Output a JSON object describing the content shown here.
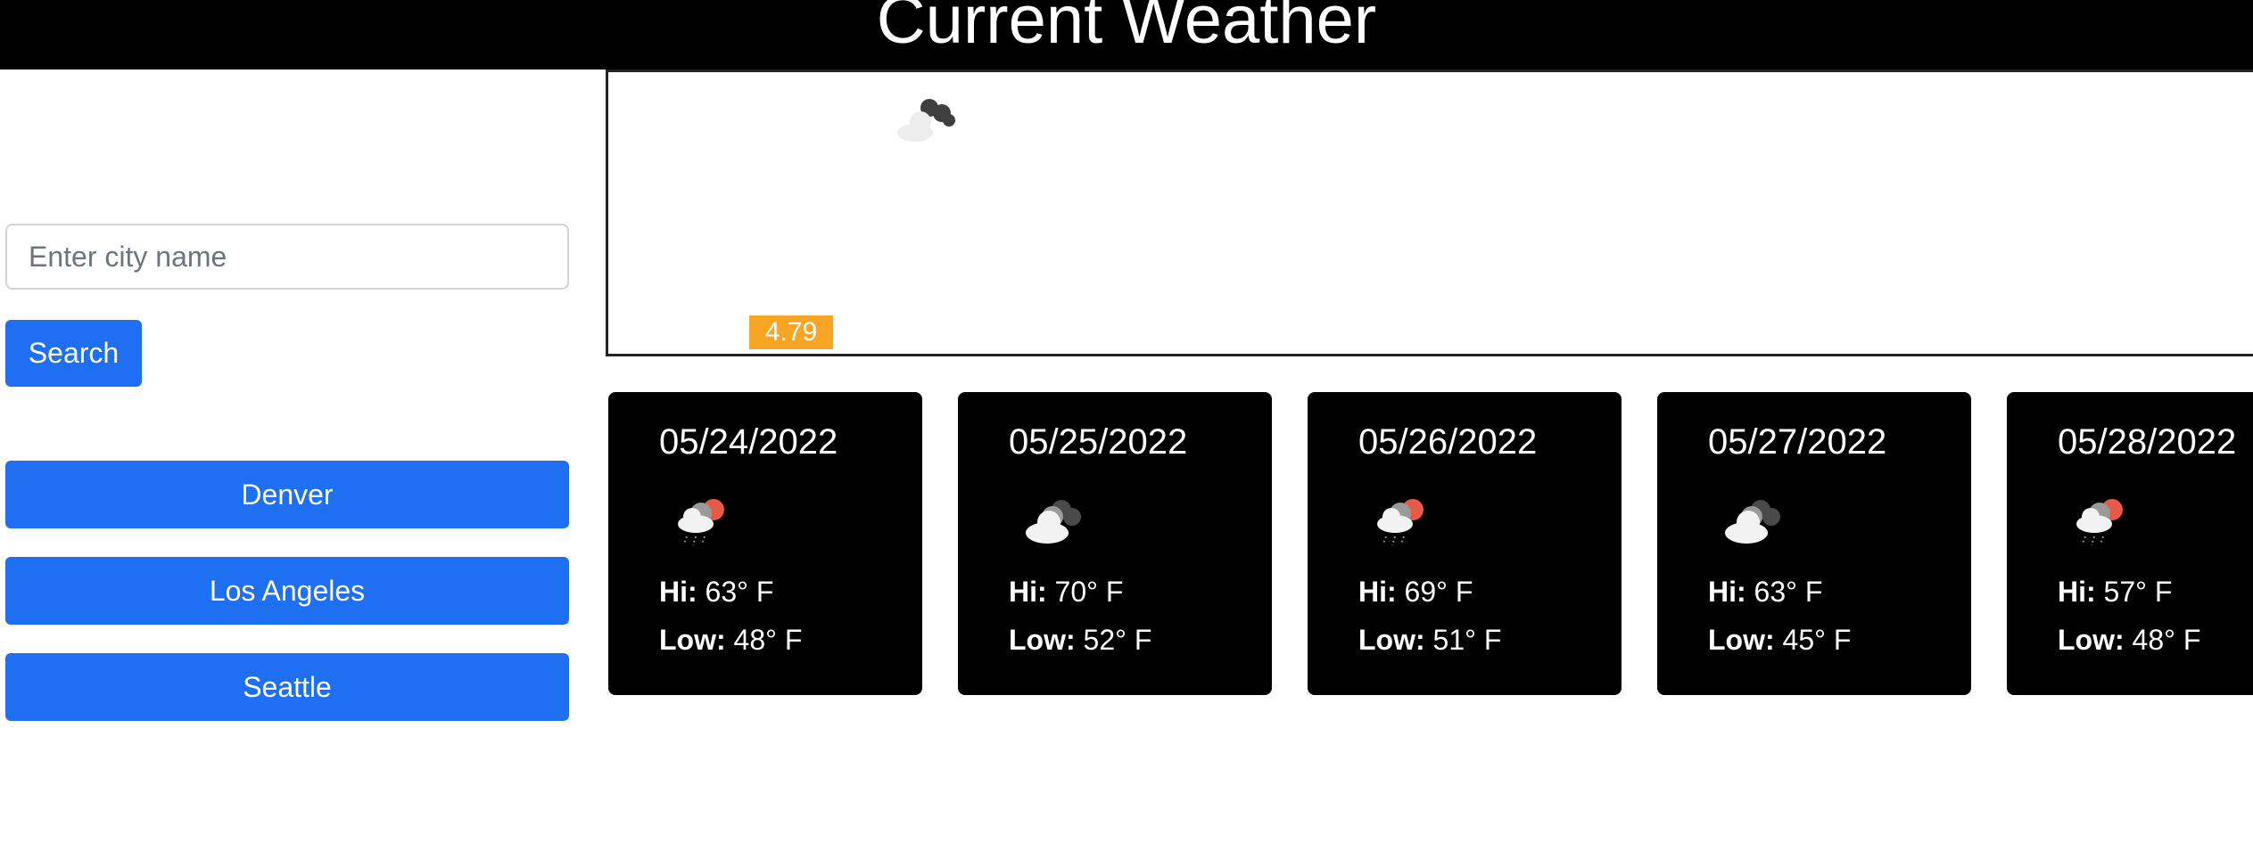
{
  "header": {
    "title": "Current Weather"
  },
  "sidebar": {
    "search_placeholder": "Enter city name",
    "search_button": "Search",
    "history": [
      "Denver",
      "Los Angeles",
      "Seattle"
    ]
  },
  "current": {
    "icon": "cloudy-night-icon",
    "wind_value": "4.79"
  },
  "forecast": [
    {
      "date": "05/24/2022",
      "icon": "rain-sun-icon",
      "hi_label": "Hi:",
      "hi": "63° F",
      "low_label": "Low:",
      "low": "48° F"
    },
    {
      "date": "05/25/2022",
      "icon": "cloudy-icon",
      "hi_label": "Hi:",
      "hi": "70° F",
      "low_label": "Low:",
      "low": "52° F"
    },
    {
      "date": "05/26/2022",
      "icon": "rain-sun-icon",
      "hi_label": "Hi:",
      "hi": "69° F",
      "low_label": "Low:",
      "low": "51° F"
    },
    {
      "date": "05/27/2022",
      "icon": "cloudy-icon",
      "hi_label": "Hi:",
      "hi": "63° F",
      "low_label": "Low:",
      "low": "45° F"
    },
    {
      "date": "05/28/2022",
      "icon": "rain-sun-icon",
      "hi_label": "Hi:",
      "hi": "57° F",
      "low_label": "Low:",
      "low": "48° F"
    }
  ],
  "colors": {
    "header_bg": "#000000",
    "primary_button": "#1f6ff2",
    "badge": "#f8a425",
    "card_bg": "#000000"
  }
}
